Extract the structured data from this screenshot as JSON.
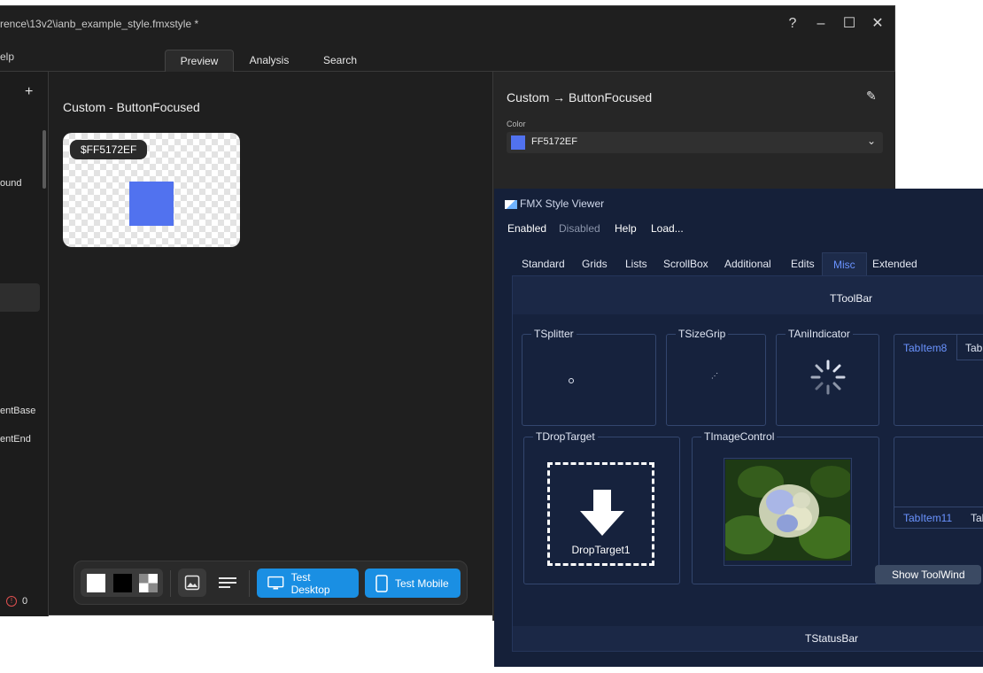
{
  "editor": {
    "title": "rence\\13v2\\ianb_example_style.fmxstyle *",
    "menu_help": "elp",
    "tabs": [
      "Preview",
      "Analysis",
      "Search"
    ],
    "active_tab": "Preview",
    "sidebar": {
      "add_label": "+",
      "items": [
        "ound",
        "entBase",
        "entEnd"
      ],
      "error_count": "0"
    },
    "preview": {
      "title": "Custom - ButtonFocused",
      "badge": "$FF5172EF",
      "swatch_color": "#5172ef"
    },
    "toolbar": {
      "test_desktop": "Test Desktop",
      "test_mobile": "Test Mobile"
    },
    "properties": {
      "title": "Custom → ButtonFocused",
      "color_label": "Color",
      "color_value": "FF5172EF",
      "color_hex": "#5172ef"
    }
  },
  "viewer": {
    "title": "FMX Style Viewer",
    "menu": [
      "Enabled",
      "Disabled",
      "Help",
      "Load..."
    ],
    "tabs": [
      "Standard",
      "Grids",
      "Lists",
      "ScrollBox",
      "Additional",
      "Edits",
      "Misc",
      "Extended"
    ],
    "active_tab": "Misc",
    "toolbar_label": "TToolBar",
    "groups": {
      "splitter": "TSplitter",
      "sizegrip": "TSizeGrip",
      "aniindicator": "TAniIndicator",
      "droptarget": "TDropTarget",
      "imagecontrol": "TImageControl"
    },
    "drop_label": "DropTarget1",
    "tab_items": [
      "TabItem8",
      "Tabl",
      "TabItem11",
      "Tab"
    ],
    "show_button": "Show ToolWind",
    "status_label": "TStatusBar"
  }
}
